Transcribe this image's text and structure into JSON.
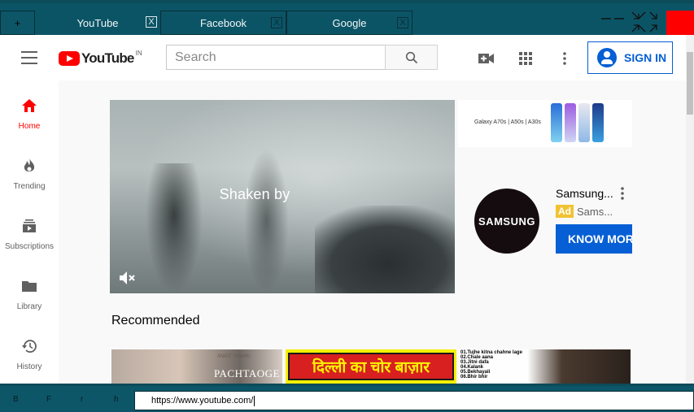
{
  "browser": {
    "new_tab_label": "+",
    "tabs": [
      {
        "label": "YouTube",
        "close": "X"
      },
      {
        "label": "Facebook",
        "close": "X"
      },
      {
        "label": "Google",
        "close": "X"
      }
    ],
    "url": "https://www.youtube.com/",
    "nav_buttons": [
      "B",
      "F",
      "r",
      "h"
    ]
  },
  "youtube": {
    "logo_text": "YouTube",
    "country_code": "IN",
    "search_placeholder": "Search",
    "sign_in_label": "SIGN IN",
    "sidebar": [
      {
        "label": "Home",
        "icon": "home-icon"
      },
      {
        "label": "Trending",
        "icon": "fire-icon"
      },
      {
        "label": "Subscriptions",
        "icon": "subscriptions-icon"
      },
      {
        "label": "Library",
        "icon": "folder-icon"
      },
      {
        "label": "History",
        "icon": "history-icon"
      }
    ],
    "video_caption": "Shaken by",
    "ad": {
      "banner_text": "Galaxy A70s | A50s | A30s",
      "logo_text": "SAMSUNG",
      "title": "Samsung...",
      "badge": "Ad",
      "subtitle": "Sams...",
      "cta": "KNOW MORE"
    },
    "recommended_title": "Recommended",
    "thumbnails": [
      {
        "text_a": "ANKIT TIWARI",
        "text_b": "PACHTAOGE"
      },
      {
        "text": "दिल्ली का चोर बाज़ार"
      },
      {
        "lines": [
          "01.Tujhe kitna chahne lage",
          "02.Chale aana",
          "03.Jitni dafa",
          "04.Kalank",
          "05.Bekhayali",
          "06.Bhir bhir"
        ]
      }
    ]
  },
  "colors": {
    "accent": "#065fd4",
    "brand_red": "#ff0000",
    "chrome": "#0b5466"
  }
}
